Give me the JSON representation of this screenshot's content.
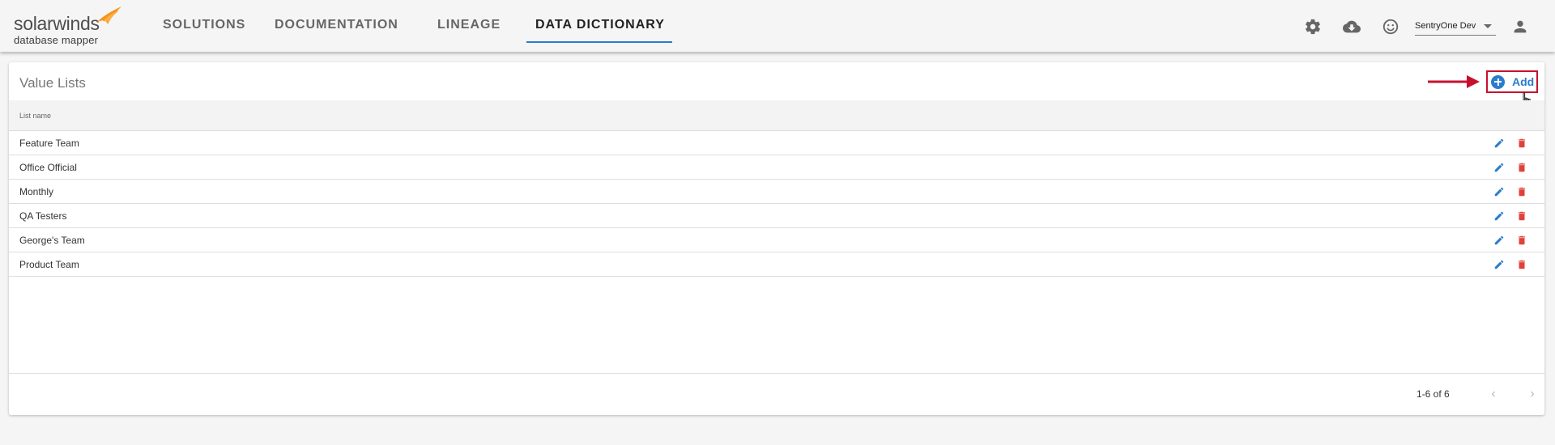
{
  "brand": {
    "name": "solarwinds",
    "product": "database mapper"
  },
  "nav": {
    "tabs": [
      {
        "label": "SOLUTIONS"
      },
      {
        "label": "DOCUMENTATION"
      },
      {
        "label": "LINEAGE"
      },
      {
        "label": "DATA DICTIONARY",
        "active": true
      }
    ]
  },
  "header": {
    "icons": [
      "gear-icon",
      "cloud-download-icon",
      "smiley-icon",
      "person-icon"
    ],
    "workspace": "SentryOne Dev"
  },
  "card": {
    "title": "Value Lists",
    "add_label": "Add",
    "column_header": "List name",
    "rows": [
      {
        "name": "Feature Team"
      },
      {
        "name": "Office Official"
      },
      {
        "name": "Monthly"
      },
      {
        "name": "QA Testers"
      },
      {
        "name": "George's Team"
      },
      {
        "name": "Product Team"
      }
    ],
    "pagination": "1-6 of 6"
  },
  "colors": {
    "accent": "#2a7ccd",
    "highlight": "#c8102e",
    "delete": "#e0413a",
    "logo_orange": "#f7941d"
  }
}
